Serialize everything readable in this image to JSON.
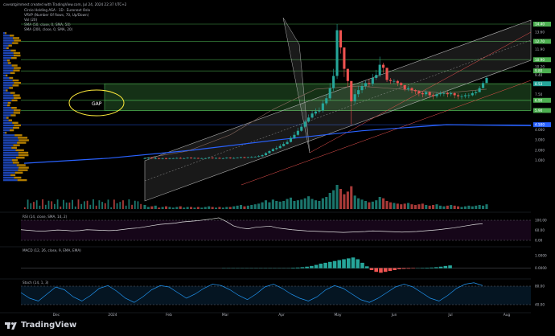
{
  "header": {
    "attribution": "caveatgimmest created with TradingView.com, Jul 24, 2024 22:37 UTC+2",
    "symbol_line": "Circio Holding ASA · 1D · Euronext Oslo",
    "vrvp_line": "VRVP (Number Of Rows, 70, Up/Down)",
    "vol_line": "Vol (20)",
    "sma50_line": "SMA (50, close, 0, SMA, 50)",
    "sma200_line": "SMA (200, close, 0, SMA, 20)"
  },
  "brand": {
    "name": "TradingView",
    "icon": "tradingview-logo-icon"
  },
  "annotations": {
    "gap_label": "GAP"
  },
  "colors": {
    "up": "#26a69a",
    "down": "#ef5350",
    "sma_blue": "#2962ff",
    "sma_orange": "#ff9800",
    "zone_green": "#4caf50",
    "ellipse_yellow": "#ffeb3b",
    "channel": "#b0b0b0",
    "rsi_purple": "#9c27b0",
    "stoch_blue": "#2196f3"
  },
  "chart_data": [
    {
      "type": "candlestick",
      "price_scale_labels": [
        "14.40",
        "13.60",
        "12.70",
        "11.90",
        "10.90",
        "10.20",
        "9.80",
        "9.40",
        "8.53",
        "7.50",
        "6.90",
        "5.90",
        "4.500",
        "4.000",
        "3.000",
        "2.000",
        "1.000"
      ],
      "highlighted_labels": [
        "14.40",
        "12.70",
        "10.90",
        "9.80",
        "8.53",
        "6.90",
        "5.90",
        "4.500"
      ],
      "current_price_label": "8.53",
      "time_labels": [
        "Dec",
        "2024",
        "Feb",
        "Mar",
        "Apr",
        "May",
        "Jun",
        "Jul",
        "Aug"
      ],
      "ylim": [
        0,
        14.4
      ],
      "candles": {
        "open": [
          1.2,
          1.2,
          1.25,
          1.2,
          1.2,
          1.15,
          1.2,
          1.18,
          1.2,
          1.2,
          1.22,
          1.2,
          1.2,
          1.25,
          1.2,
          1.22,
          1.2,
          1.2,
          1.2,
          1.25,
          1.2,
          1.22,
          1.2,
          1.2,
          1.25,
          1.2,
          1.22,
          1.25,
          1.3,
          1.28,
          1.3,
          1.32,
          1.35,
          1.4,
          1.5,
          1.7,
          1.9,
          2.1,
          2.2,
          2.4,
          2.6,
          2.8,
          3.2,
          3.5,
          3.9,
          4.3,
          4.8,
          5.2,
          5.6,
          5.8,
          5.9,
          6.6,
          7.1,
          8.1,
          9.3,
          13.8,
          12.1,
          10.0,
          8.8,
          6.8,
          7.5,
          7.9,
          8.3,
          8.6,
          8.5,
          9.1,
          9.4,
          10.4,
          10.1,
          8.9,
          8.8,
          8.8,
          8.6,
          8.4,
          8.0,
          8.1,
          7.9,
          7.8,
          7.6,
          7.5,
          7.7,
          7.4,
          7.3,
          7.5,
          7.6,
          7.6,
          7.5,
          7.6,
          7.4,
          7.3,
          7.3,
          7.4,
          7.4,
          7.6,
          7.7,
          8.1,
          8.6
        ],
        "close": [
          1.2,
          1.25,
          1.2,
          1.2,
          1.15,
          1.2,
          1.18,
          1.2,
          1.2,
          1.22,
          1.2,
          1.2,
          1.25,
          1.2,
          1.22,
          1.2,
          1.2,
          1.2,
          1.25,
          1.2,
          1.22,
          1.2,
          1.2,
          1.25,
          1.2,
          1.22,
          1.25,
          1.3,
          1.28,
          1.3,
          1.32,
          1.35,
          1.4,
          1.5,
          1.7,
          1.9,
          2.1,
          2.2,
          2.4,
          2.6,
          2.8,
          3.2,
          3.5,
          3.9,
          4.3,
          4.8,
          5.2,
          5.6,
          5.8,
          5.9,
          6.6,
          7.1,
          8.1,
          9.3,
          13.8,
          12.1,
          10.0,
          8.8,
          6.8,
          7.5,
          7.9,
          8.3,
          8.6,
          8.5,
          9.1,
          9.4,
          10.4,
          10.1,
          8.9,
          8.8,
          8.8,
          8.6,
          8.4,
          8.0,
          8.1,
          7.9,
          7.8,
          7.6,
          7.5,
          7.7,
          7.4,
          7.3,
          7.5,
          7.6,
          7.6,
          7.5,
          7.6,
          7.4,
          7.3,
          7.3,
          7.4,
          7.4,
          7.6,
          7.7,
          8.1,
          8.6,
          9.1
        ],
        "high": [
          1.3,
          1.3,
          1.3,
          1.3,
          1.25,
          1.25,
          1.25,
          1.25,
          1.25,
          1.3,
          1.3,
          1.25,
          1.3,
          1.3,
          1.3,
          1.25,
          1.25,
          1.25,
          1.3,
          1.3,
          1.3,
          1.3,
          1.25,
          1.3,
          1.3,
          1.3,
          1.3,
          1.35,
          1.35,
          1.35,
          1.4,
          1.4,
          1.5,
          1.6,
          1.8,
          2.0,
          2.2,
          2.4,
          2.6,
          2.8,
          3.0,
          3.4,
          3.8,
          4.2,
          4.6,
          5.0,
          5.5,
          5.9,
          6.1,
          6.2,
          6.9,
          7.5,
          8.6,
          10.0,
          14.4,
          13.0,
          10.6,
          9.2,
          8.0,
          8.0,
          8.3,
          8.7,
          8.9,
          9.0,
          9.5,
          9.9,
          11.2,
          10.6,
          9.4,
          9.1,
          9.0,
          8.9,
          8.7,
          8.3,
          8.3,
          8.2,
          8.0,
          7.9,
          7.8,
          7.9,
          7.8,
          7.6,
          7.7,
          7.8,
          7.8,
          7.8,
          7.8,
          7.7,
          7.6,
          7.5,
          7.6,
          7.6,
          7.8,
          7.9,
          8.3,
          8.8,
          9.3
        ],
        "low": [
          1.1,
          1.1,
          1.15,
          1.1,
          1.1,
          1.1,
          1.1,
          1.1,
          1.15,
          1.15,
          1.15,
          1.15,
          1.15,
          1.15,
          1.15,
          1.15,
          1.15,
          1.15,
          1.15,
          1.15,
          1.15,
          1.15,
          1.15,
          1.15,
          1.15,
          1.15,
          1.2,
          1.2,
          1.2,
          1.25,
          1.25,
          1.3,
          1.3,
          1.35,
          1.45,
          1.65,
          1.85,
          2.0,
          2.15,
          2.35,
          2.55,
          2.75,
          3.1,
          3.4,
          3.8,
          4.2,
          4.7,
          5.1,
          5.4,
          5.6,
          5.7,
          6.4,
          6.9,
          7.8,
          9.0,
          11.5,
          9.2,
          8.2,
          4.5,
          6.5,
          7.2,
          7.6,
          8.0,
          8.2,
          8.3,
          8.9,
          9.2,
          9.6,
          8.7,
          8.5,
          8.5,
          8.3,
          8.1,
          7.8,
          7.8,
          7.6,
          7.5,
          7.3,
          7.2,
          7.3,
          7.1,
          7.0,
          7.1,
          7.3,
          7.3,
          7.2,
          7.3,
          7.1,
          7.0,
          7.0,
          7.1,
          7.1,
          7.3,
          7.4,
          7.8,
          8.3,
          8.7
        ]
      },
      "volume": [
        0.6,
        0.3,
        0.4,
        0.5,
        0.2,
        0.3,
        0.4,
        0.3,
        0.2,
        0.3,
        0.4,
        0.2,
        0.3,
        0.3,
        0.2,
        0.3,
        0.2,
        0.3,
        0.4,
        0.3,
        0.2,
        0.3,
        0.2,
        0.3,
        0.3,
        0.4,
        0.5,
        0.6,
        0.4,
        0.5,
        0.6,
        0.7,
        0.8,
        1.0,
        1.3,
        1.0,
        1.4,
        1.2,
        1.1,
        1.2,
        1.5,
        1.7,
        1.2,
        1.3,
        1.4,
        1.6,
        1.9,
        1.5,
        1.3,
        1.2,
        1.6,
        1.8,
        2.4,
        2.8,
        3.6,
        3.0,
        2.2,
        2.6,
        3.4,
        2.0,
        1.6,
        1.4,
        1.2,
        1.0,
        1.1,
        1.3,
        1.8,
        1.6,
        1.2,
        1.0,
        0.9,
        0.8,
        0.7,
        0.8,
        0.9,
        0.7,
        0.6,
        0.7,
        0.8,
        0.6,
        0.5,
        0.6,
        0.7,
        0.5,
        0.4,
        0.5,
        0.6,
        0.5,
        0.4,
        0.3,
        0.4,
        0.5,
        0.4,
        0.5,
        0.6,
        0.5,
        0.7
      ],
      "sma50_blue": [
        0.7,
        1.2,
        2.0,
        3.0,
        3.9,
        4.5,
        4.4
      ],
      "sma200_orange": [
        1.2,
        1.9,
        3.5,
        6.0,
        8.0,
        8.3,
        8.0,
        7.6,
        8.0
      ],
      "zones": [
        {
          "from": 6.9,
          "to": 8.53,
          "color": "green"
        },
        {
          "from": 5.9,
          "to": 6.9,
          "color": "green"
        }
      ],
      "levels": [
        14.4,
        12.7,
        10.9,
        9.8,
        8.53,
        6.9,
        5.9,
        4.5
      ]
    },
    {
      "type": "line",
      "name": "RSI",
      "legend": "RSI (14, close, SMA, 14, 2)",
      "scale_labels": [
        "100.00",
        "60.00",
        "0.00"
      ],
      "values": [
        52,
        50,
        48,
        47,
        49,
        51,
        50,
        48,
        49,
        52,
        51,
        50,
        49,
        50,
        53,
        56,
        58,
        62,
        66,
        70,
        72,
        74,
        78,
        80,
        82,
        85,
        88,
        92,
        80,
        65,
        58,
        55,
        60,
        62,
        64,
        58,
        55,
        52,
        50,
        48,
        47,
        46,
        45,
        44,
        43,
        44,
        45,
        46,
        48,
        47,
        46,
        45,
        44,
        45,
        46,
        48,
        50,
        52,
        55,
        58,
        62,
        66,
        70,
        72
      ]
    },
    {
      "type": "bar",
      "name": "MACD",
      "legend": "MACD (12, 26, close, 9, EMA, EMA)",
      "scale_labels": [
        "1.0000",
        "0.0000"
      ],
      "values": [
        0,
        0,
        0,
        0,
        0,
        0,
        0,
        0,
        0,
        0,
        0,
        0,
        0,
        0,
        0,
        0.02,
        0.03,
        0.05,
        0.08,
        0.12,
        0.18,
        0.25,
        0.3,
        0.35,
        0.4,
        0.45,
        0.5,
        0.55,
        0.6,
        0.5,
        0.3,
        0.1,
        -0.1,
        -0.2,
        -0.25,
        -0.2,
        -0.15,
        -0.1,
        -0.05,
        -0.03,
        -0.02,
        -0.01,
        0,
        0.01,
        0.02,
        0.03,
        0.05,
        0.08,
        0.12,
        0.15
      ]
    },
    {
      "type": "line",
      "name": "Stoch",
      "legend": "Stoch (14, 1, 3)",
      "scale_labels": [
        "80.00",
        "40.00"
      ],
      "values": [
        60,
        40,
        30,
        55,
        80,
        70,
        45,
        30,
        50,
        75,
        85,
        65,
        40,
        25,
        45,
        70,
        85,
        80,
        60,
        40,
        55,
        75,
        90,
        85,
        70,
        50,
        35,
        55,
        80,
        90,
        75,
        55,
        40,
        30,
        45,
        70,
        85,
        75,
        55,
        35,
        25,
        40,
        60,
        80,
        90,
        80,
        60,
        40,
        30,
        50,
        75,
        90,
        95,
        85
      ]
    }
  ]
}
